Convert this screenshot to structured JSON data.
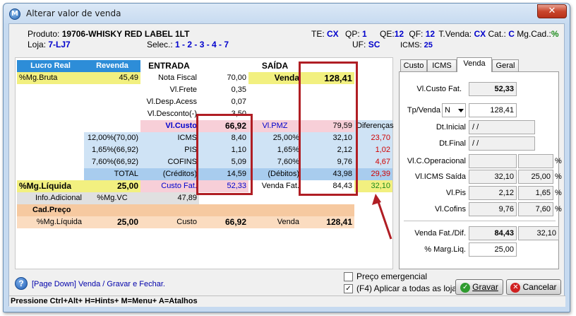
{
  "window": {
    "title": "Alterar valor de venda",
    "close": "✕"
  },
  "header": {
    "produto_label": "Produto:",
    "produto_value": "19706-WHISKY RED LABEL 1LT",
    "loja_label": "Loja:",
    "loja_value": "7-LJ7",
    "selec_label": "Selec.:",
    "selec_value": "1 - 2 - 3 - 4 - 7",
    "te_label": "TE:",
    "te_value": "CX",
    "qp_label": "QP:",
    "qp_value": "1",
    "qe_label": "QE:",
    "qe_value": "12",
    "qf_label": "QF:",
    "qf_value": "12",
    "tvenda_label": "T.Venda:",
    "tvenda_value": "CX",
    "cat_label": "Cat.:",
    "cat_value": "C",
    "mgcad_label": "Mg.Cad.:",
    "mgcad_value": "%",
    "uf_label": "UF:",
    "uf_value": "SC",
    "icms_label": "ICMS:",
    "icms_value": "25"
  },
  "grid": {
    "lucro_real": "Lucro Real",
    "revenda": "Revenda",
    "entrada": "ENTRADA",
    "saida": "SAÍDA",
    "mg_bruta_label": "%Mg.Bruta",
    "mg_bruta_value": "45,49",
    "nota_fiscal_label": "Nota Fiscal",
    "nota_fiscal_value": "70,00",
    "venda_label": "Venda",
    "venda_value": "128,41",
    "vl_frete_label": "Vl.Frete",
    "vl_frete_value": "0,35",
    "vl_desp_label": "Vl.Desp.Acess",
    "vl_desp_value": "0,07",
    "vl_desc_label": "Vl.Desconto(-)",
    "vl_desc_value": "3,50",
    "vl_custo_label": "Vl.Custo",
    "vl_custo_value": "66,92",
    "vl_pmz_label": "Vl.PMZ",
    "vl_pmz_value": "79,59",
    "diferencas_label": "Diferenças",
    "icms_row": {
      "base": "12,00%(70,00)",
      "label": "ICMS",
      "entrada": "8,40",
      "pct": "25,00%",
      "saida": "32,10",
      "dif": "23,70"
    },
    "pis_row": {
      "base": "1,65%(66,92)",
      "label": "PIS",
      "entrada": "1,10",
      "pct": "1,65%",
      "saida": "2,12",
      "dif": "1,02"
    },
    "cofins_row": {
      "base": "7,60%(66,92)",
      "label": "COFINS",
      "entrada": "5,09",
      "pct": "7,60%",
      "saida": "9,76",
      "dif": "4,67"
    },
    "total_row": {
      "base": "TOTAL",
      "label": "(Créditos)",
      "entrada": "14,59",
      "pct": "(Débitos)",
      "saida": "43,98",
      "dif": "29,39"
    },
    "mg_liquida_label": "%Mg.Líquida",
    "mg_liquida_value": "25,00",
    "custo_fat_label": "Custo Fat.",
    "custo_fat_value": "52,33",
    "venda_fat_label": "Venda Fat.",
    "venda_fat_value": "84,43",
    "venda_fat_dif": "32,10",
    "info_adicional": "Info.Adicional",
    "mg_vc_label": "%Mg.VC",
    "mg_vc_value": "47,89",
    "cad_preco": "Cad.Preço",
    "cad_mg_label": "%Mg.Líquida",
    "cad_mg_value": "25,00",
    "cad_custo_label": "Custo",
    "cad_custo_value": "66,92",
    "cad_venda_label": "Venda",
    "cad_venda_value": "128,41"
  },
  "tabs": [
    {
      "label": "Custo"
    },
    {
      "label": "ICMS"
    },
    {
      "label": "Venda"
    },
    {
      "label": "Geral"
    }
  ],
  "venda_tab": {
    "vl_custo_fat_label": "Vl.Custo Fat.",
    "vl_custo_fat_value": "52,33",
    "tp_venda_label": "Tp/Venda",
    "tp_venda_value": "N",
    "tp_venda_amount": "128,41",
    "dt_inicial_label": "Dt.Inicial",
    "dt_inicial_value": " / /",
    "dt_final_label": "Dt.Final",
    "dt_final_value": " / /",
    "vl_c_oper_label": "Vl.C.Operacional",
    "vl_c_oper_value": "",
    "vl_c_oper_pct": "",
    "vl_icms_saida_label": "Vl.ICMS Saída",
    "vl_icms_saida_value": "32,10",
    "vl_icms_saida_pct": "25,00",
    "vl_pis_label": "Vl.Pis",
    "vl_pis_value": "2,12",
    "vl_pis_pct": "1,65",
    "vl_cofins_label": "Vl.Cofins",
    "vl_cofins_value": "9,76",
    "vl_cofins_pct": "7,60",
    "venda_fat_dif_label": "Venda Fat./Dif.",
    "venda_fat_dif_value": "84,43",
    "venda_fat_dif_value2": "32,10",
    "marg_liq_label": "% Marg.Liq.",
    "marg_liq_value": "25,00",
    "percent_sign": "%"
  },
  "footer": {
    "hint": "[Page Down] Venda / Gravar e Fechar.",
    "preco_emergencial": "Preço emergencial",
    "aplicar_label": "(F4) Aplicar a todas as lojas.",
    "aplicar_checked": "✓",
    "gravar": "Gravar",
    "cancelar": "Cancelar"
  },
  "statusbar": {
    "text": "Pressione Ctrl+Alt+ H=Hints+ M=Menu+ A=Atalhos"
  },
  "colors": {
    "accent_blue": "#2d8dd8",
    "highlight_red": "#b01e24",
    "yellow": "#f2f080"
  }
}
